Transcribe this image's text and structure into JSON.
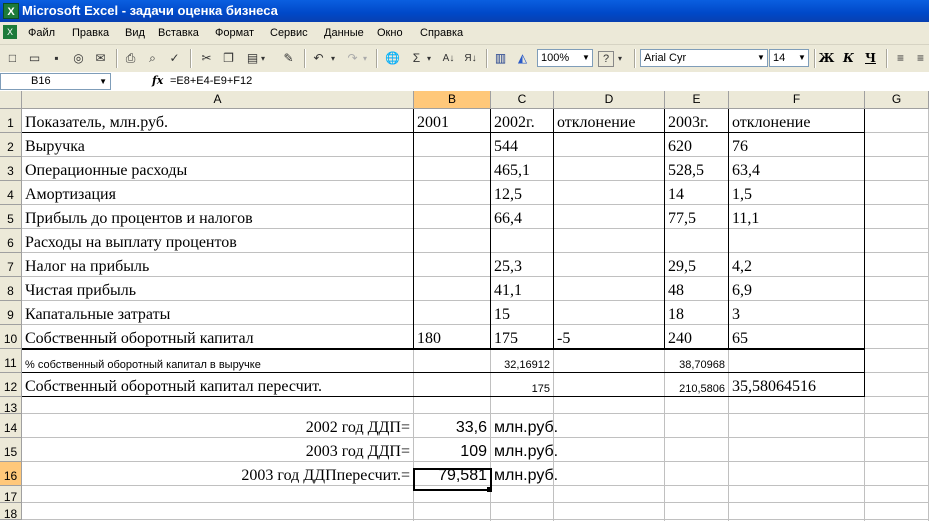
{
  "window": {
    "title": "Microsoft Excel - задачи оценка бизнеса"
  },
  "menu": [
    "Файл",
    "Правка",
    "Вид",
    "Вставка",
    "Формат",
    "Сервис",
    "Данные",
    "Окно",
    "Справка"
  ],
  "toolbar": {
    "zoom": "100%",
    "font": "Arial Cyr",
    "size": "14",
    "bold": "Ж",
    "italic": "К",
    "underline": "Ч"
  },
  "formula_bar": {
    "name_box": "B16",
    "fx": "fx",
    "formula": "=E8+E4-E9+F12"
  },
  "columns": [
    "A",
    "B",
    "C",
    "D",
    "E",
    "F",
    "G"
  ],
  "rows": [
    "1",
    "2",
    "3",
    "4",
    "5",
    "6",
    "7",
    "8",
    "9",
    "10",
    "11",
    "12",
    "13",
    "14",
    "15",
    "16",
    "17",
    "18"
  ],
  "cells": {
    "A1": "Показатель, млн.руб.",
    "B1": "2001",
    "C1": "2002г.",
    "D1": "отклонение",
    "E1": "2003г.",
    "F1": "отклонение",
    "A2": "Выручка",
    "C2": "544",
    "E2": "620",
    "F2": "76",
    "A3": "Операционные расходы",
    "C3": "465,1",
    "E3": "528,5",
    "F3": "63,4",
    "A4": "Амортизация",
    "C4": "12,5",
    "E4": "14",
    "F4": "1,5",
    "A5": "Прибыль до процентов и налогов",
    "C5": "66,4",
    "E5": "77,5",
    "F5": "11,1",
    "A6": "Расходы на выплату процентов",
    "A7": "Налог на прибыль",
    "C7": "25,3",
    "E7": "29,5",
    "F7": "4,2",
    "A8": "Чистая прибыль",
    "C8": "41,1",
    "E8": "48",
    "F8": "6,9",
    "A9": "Капатальные затраты",
    "C9": "15",
    "E9": "18",
    "F9": "3",
    "A10": "Собственный оборотный капитал",
    "B10": "180",
    "C10": "175",
    "D10": "-5",
    "E10": "240",
    "F10": "65",
    "A11": "% собственный оборотный капитал в выручке",
    "C11": "32,16912",
    "E11": "38,70968",
    "A12": "Собственный оборотный капитал пересчит.",
    "C12": "175",
    "E12": "210,5806",
    "F12": "35,58064516",
    "A14": "2002 год  ДДП=",
    "B14": "33,6",
    "C14": "млн.руб.",
    "A15": "2003 год  ДДП=",
    "B15": "109",
    "C15": "млн.руб.",
    "A16": "2003 год  ДДПпересчит.=",
    "B16": "79,581",
    "C16": "млн.руб."
  }
}
